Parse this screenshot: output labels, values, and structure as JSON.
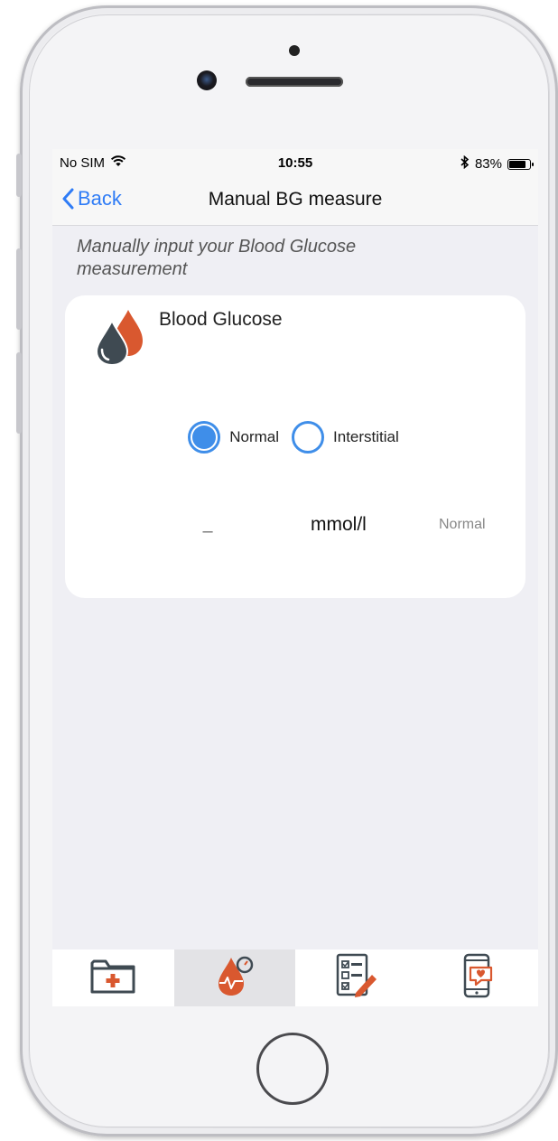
{
  "status_bar": {
    "carrier": "No SIM",
    "time": "10:55",
    "battery_percent": "83%",
    "battery_level": 0.83,
    "icons": [
      "wifi-icon",
      "bluetooth-icon",
      "battery-icon"
    ]
  },
  "nav": {
    "back_label": "Back",
    "title": "Manual BG measure"
  },
  "hint": "Manually input your Blood Glucose measurement",
  "card": {
    "title": "Blood Glucose",
    "icon": "blood-drops-icon",
    "options": [
      {
        "label": "Normal",
        "selected": true
      },
      {
        "label": "Interstitial",
        "selected": false
      }
    ],
    "value_placeholder": "–",
    "unit": "mmol/l",
    "range_label": "Normal"
  },
  "tabs": [
    {
      "icon": "medical-folder-icon",
      "active": false
    },
    {
      "icon": "blood-drop-gauge-icon",
      "active": true
    },
    {
      "icon": "checklist-edit-icon",
      "active": false
    },
    {
      "icon": "phone-heart-icon",
      "active": false
    }
  ],
  "colors": {
    "accent": "#2f7cf6",
    "radio": "#3f8ee9",
    "drop_dark": "#3f4a52",
    "drop_orange": "#d9582f"
  }
}
